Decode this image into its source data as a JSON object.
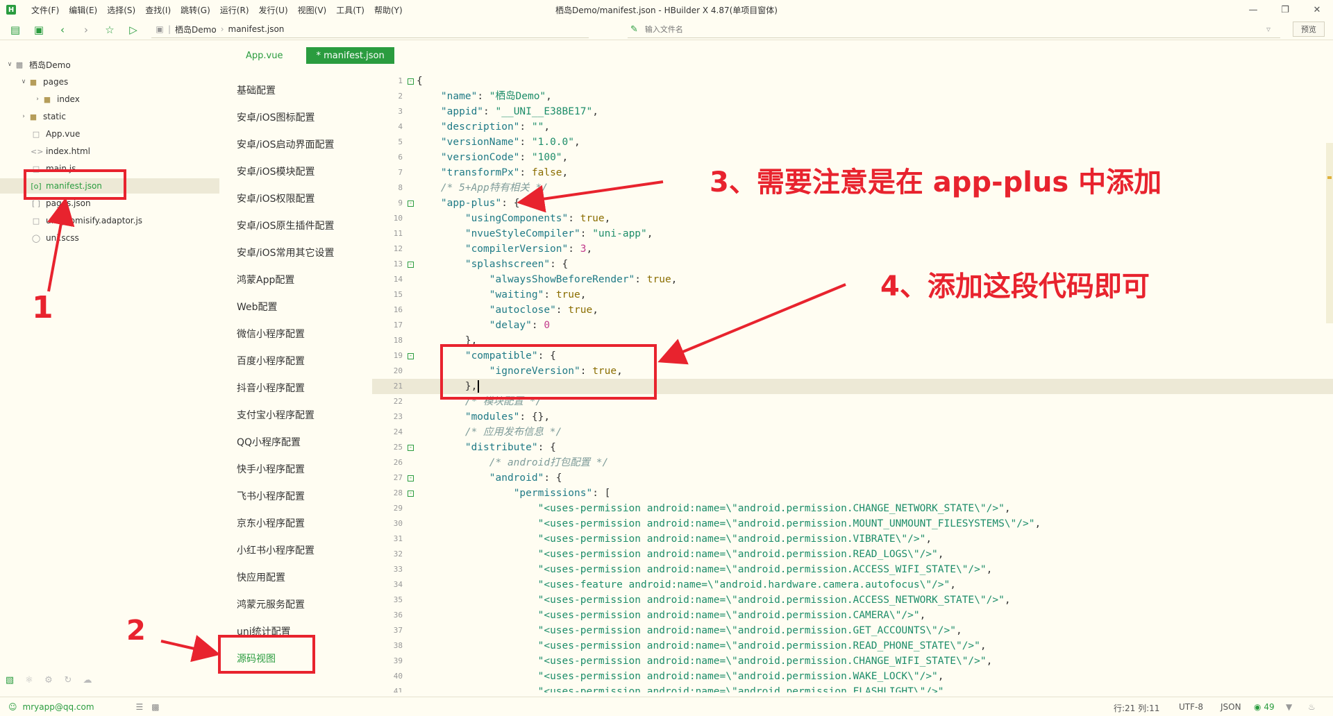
{
  "window": {
    "title": "栖岛Demo/manifest.json - HBuilder X 4.87(单项目窗体)",
    "logo": "H",
    "menu": [
      "文件(F)",
      "编辑(E)",
      "选择(S)",
      "查找(I)",
      "跳转(G)",
      "运行(R)",
      "发行(U)",
      "视图(V)",
      "工具(T)",
      "帮助(Y)"
    ]
  },
  "toolbar": {
    "breadcrumb": [
      "栖岛Demo",
      "manifest.json"
    ],
    "search_placeholder": "输入文件名",
    "preview_label": "预览",
    "icons": [
      "new-file-icon",
      "save-icon",
      "back-icon",
      "forward-icon",
      "star-icon",
      "run-icon"
    ]
  },
  "tree": {
    "project": "栖岛Demo",
    "items": [
      {
        "label": "栖岛Demo"
      },
      {
        "label": "pages"
      },
      {
        "label": "index"
      },
      {
        "label": "static"
      },
      {
        "label": "App.vue"
      },
      {
        "label": "index.html"
      },
      {
        "label": "main.js"
      },
      {
        "label": "manifest.json"
      },
      {
        "label": "pages.json"
      },
      {
        "label": "uni.promisify.adaptor.js"
      },
      {
        "label": "uni.scss"
      }
    ]
  },
  "tabs": [
    {
      "label": "App.vue"
    },
    {
      "label": "* manifest.json"
    }
  ],
  "config_nav": [
    "基础配置",
    "安卓/iOS图标配置",
    "安卓/iOS启动界面配置",
    "安卓/iOS模块配置",
    "安卓/iOS权限配置",
    "安卓/iOS原生插件配置",
    "安卓/iOS常用其它设置",
    "鸿蒙App配置",
    "Web配置",
    "微信小程序配置",
    "百度小程序配置",
    "抖音小程序配置",
    "支付宝小程序配置",
    "QQ小程序配置",
    "快手小程序配置",
    "飞书小程序配置",
    "京东小程序配置",
    "小红书小程序配置",
    "快应用配置",
    "鸿蒙元服务配置",
    "uni统计配置",
    "源码视图"
  ],
  "code": [
    "{",
    "    \"name\": \"栖岛Demo\",",
    "    \"appid\": \"__UNI__E38BE17\",",
    "    \"description\": \"\",",
    "    \"versionName\": \"1.0.0\",",
    "    \"versionCode\": \"100\",",
    "    \"transformPx\": false,",
    "    /* 5+App特有相关 */",
    "    \"app-plus\": {",
    "        \"usingComponents\": true,",
    "        \"nvueStyleCompiler\": \"uni-app\",",
    "        \"compilerVersion\": 3,",
    "        \"splashscreen\": {",
    "            \"alwaysShowBeforeRender\": true,",
    "            \"waiting\": true,",
    "            \"autoclose\": true,",
    "            \"delay\": 0",
    "        },",
    "        \"compatible\": {",
    "            \"ignoreVersion\": true,",
    "        },",
    "        /* 模块配置 */",
    "        \"modules\": {},",
    "        /* 应用发布信息 */",
    "        \"distribute\": {",
    "            /* android打包配置 */",
    "            \"android\": {",
    "                \"permissions\": [",
    "                    \"<uses-permission android:name=\\\"android.permission.CHANGE_NETWORK_STATE\\\"/>\",",
    "                    \"<uses-permission android:name=\\\"android.permission.MOUNT_UNMOUNT_FILESYSTEMS\\\"/>\",",
    "                    \"<uses-permission android:name=\\\"android.permission.VIBRATE\\\"/>\",",
    "                    \"<uses-permission android:name=\\\"android.permission.READ_LOGS\\\"/>\",",
    "                    \"<uses-permission android:name=\\\"android.permission.ACCESS_WIFI_STATE\\\"/>\",",
    "                    \"<uses-feature android:name=\\\"android.hardware.camera.autofocus\\\"/>\",",
    "                    \"<uses-permission android:name=\\\"android.permission.ACCESS_NETWORK_STATE\\\"/>\",",
    "                    \"<uses-permission android:name=\\\"android.permission.CAMERA\\\"/>\",",
    "                    \"<uses-permission android:name=\\\"android.permission.GET_ACCOUNTS\\\"/>\",",
    "                    \"<uses-permission android:name=\\\"android.permission.READ_PHONE_STATE\\\"/>\",",
    "                    \"<uses-permission android:name=\\\"android.permission.CHANGE_WIFI_STATE\\\"/>\",",
    "                    \"<uses-permission android:name=\\\"android.permission.WAKE_LOCK\\\"/>\",",
    "                    \"<uses-permission android:name=\\\"android.permission.FLASHLIGHT\\\"/>\","
  ],
  "fold_lines": [
    1,
    9,
    13,
    19,
    25,
    27,
    28
  ],
  "current_line": 21,
  "status": {
    "account": "mryapp@qq.com",
    "position": "行:21  列:11",
    "encoding": "UTF-8",
    "language": "JSON",
    "notifications": "49"
  },
  "annotations": {
    "label_1": "1",
    "label_2": "2",
    "label_3": "3、需要注意是在 app-plus 中添加",
    "label_4": "4、添加这段代码即可",
    "color": "#e8232e"
  },
  "colors": {
    "accent": "#2a9c3f",
    "background": "#fffdf2",
    "annotation": "#e8232e"
  }
}
